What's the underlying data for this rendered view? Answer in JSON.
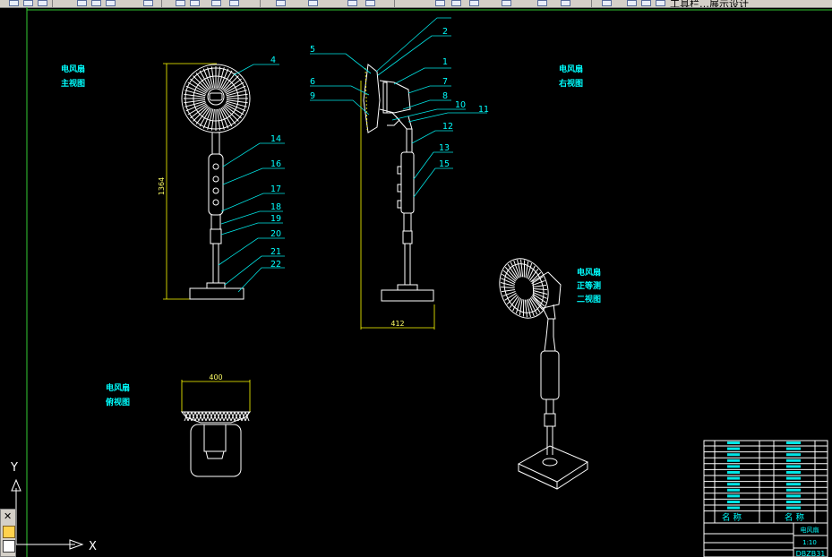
{
  "toolbar": {
    "partial_text": "工具栏…展示设计"
  },
  "front_view": {
    "title_line1": "电风扇",
    "title_line2": "主视图",
    "height_dim": "1364",
    "callouts": [
      "4",
      "14",
      "16",
      "17",
      "18",
      "19",
      "20",
      "21",
      "22"
    ]
  },
  "side_view": {
    "width_dim": "412",
    "callouts_left": [
      "5",
      "6",
      "9"
    ],
    "callouts_right": [
      "2",
      "1",
      "7",
      "8",
      "10",
      "11",
      "12",
      "13",
      "15"
    ]
  },
  "right_label": {
    "line1": "电风扇",
    "line2": "右视图"
  },
  "top_view": {
    "title_line1": "电风扇",
    "title_line2": "俯视图",
    "width_dim": "400"
  },
  "iso_view": {
    "line1": "电风扇",
    "line2": "正等测",
    "line3": "二视图"
  },
  "ucs": {
    "y_label": "Y",
    "x_label": "X"
  },
  "title_block": {
    "header_left": "名 称",
    "header_right": "名 称",
    "drawing_title": "电风扇",
    "scale": "1:10",
    "drawing_number": "DBZB31"
  },
  "colors": {
    "background": "#000000",
    "lines": "#ffffff",
    "dimensions": "#ffff00",
    "labels": "#00ffff",
    "frame": "#33cc33"
  }
}
